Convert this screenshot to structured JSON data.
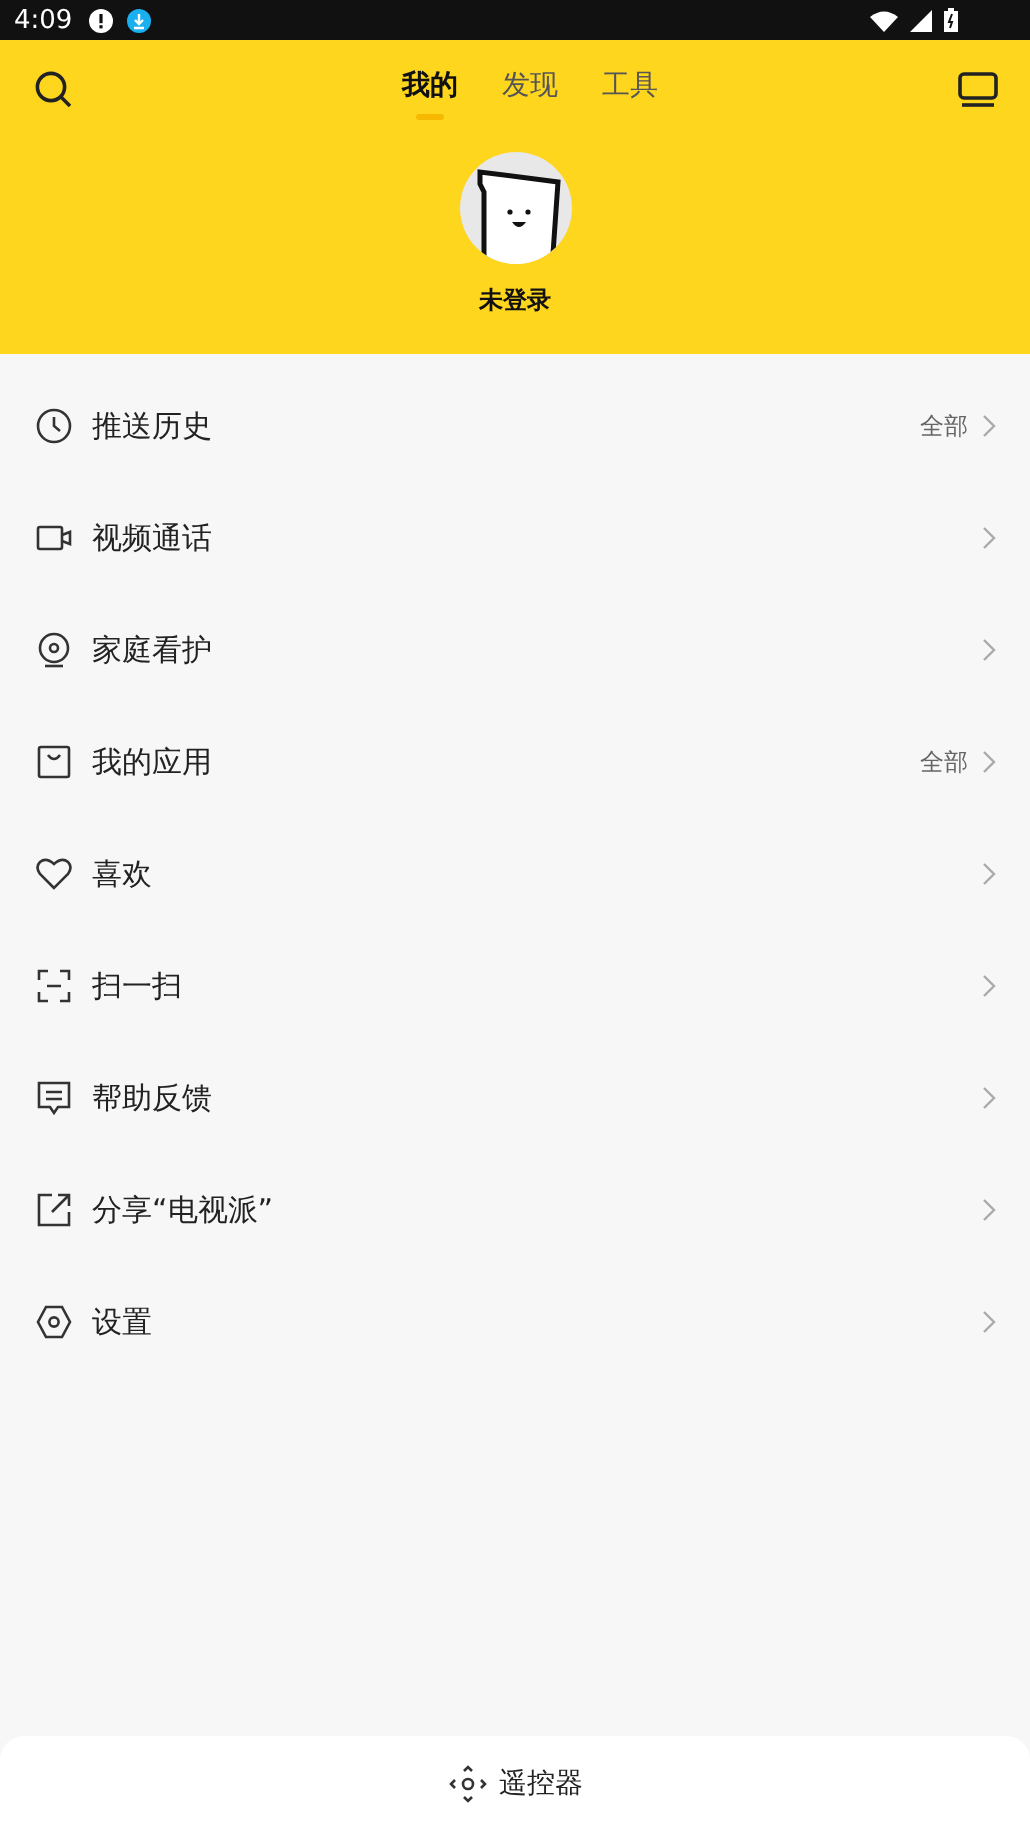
{
  "status_bar": {
    "time": "4:09"
  },
  "tabs": [
    {
      "label": "我的",
      "selected": true
    },
    {
      "label": "发现",
      "selected": false
    },
    {
      "label": "工具",
      "selected": false
    }
  ],
  "profile": {
    "name": "未登录"
  },
  "menu": [
    {
      "kind": "clock",
      "label": "推送历史",
      "extra": "全部"
    },
    {
      "kind": "video",
      "label": "视频通话"
    },
    {
      "kind": "camera",
      "label": "家庭看护"
    },
    {
      "kind": "bag",
      "label": "我的应用",
      "extra": "全部"
    },
    {
      "kind": "heart",
      "label": "喜欢"
    },
    {
      "kind": "scan",
      "label": "扫一扫"
    },
    {
      "kind": "message",
      "label": "帮助反馈"
    },
    {
      "kind": "share",
      "label": "分享“电视派”"
    },
    {
      "kind": "hexagon",
      "label": "设置"
    }
  ],
  "bottom": {
    "label": "遥控器"
  }
}
